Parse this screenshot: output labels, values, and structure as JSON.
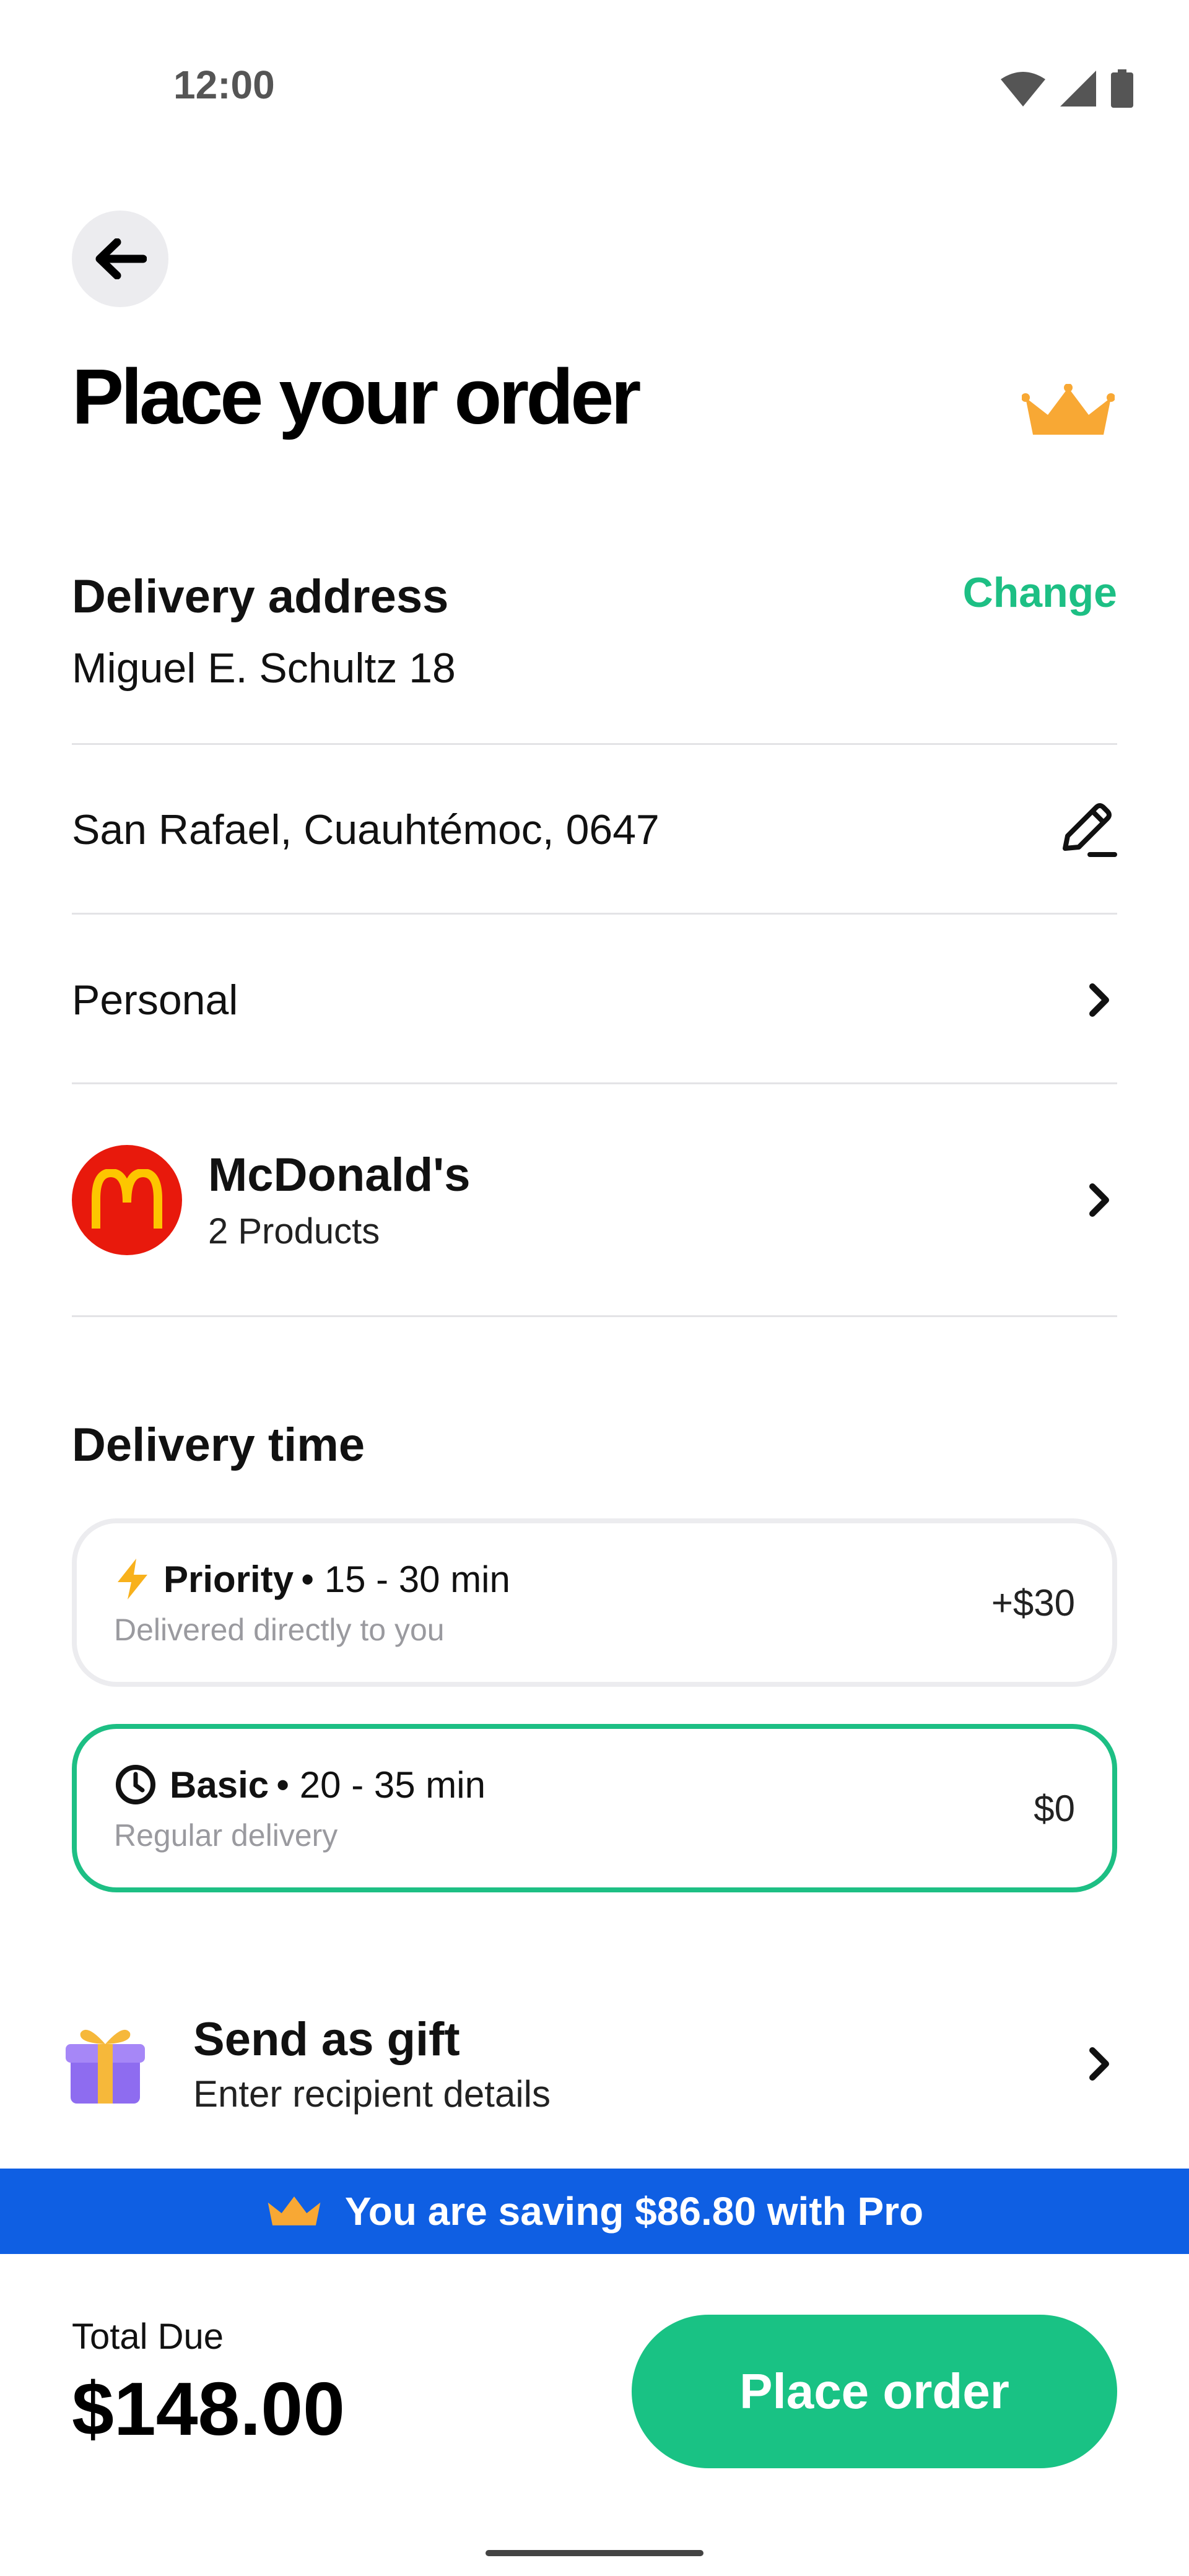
{
  "status_bar": {
    "time": "12:00",
    "icons": [
      "wifi-icon",
      "signal-icon",
      "battery-icon"
    ]
  },
  "header": {
    "title": "Place your order",
    "back_icon": "arrow-left-icon",
    "badge_icon": "crown-icon"
  },
  "delivery_address": {
    "title": "Delivery address",
    "change_label": "Change",
    "name": "Miguel E. Schultz 18",
    "address": "San Rafael, Cuauhtémoc, 0647",
    "type": "Personal"
  },
  "restaurant": {
    "name": "McDonald's",
    "products": "2 Products"
  },
  "delivery_time": {
    "title": "Delivery time",
    "options": [
      {
        "name": "Priority",
        "time": "• 15 - 30 min",
        "subtitle": "Delivered directly to you",
        "price": "+$30",
        "icon": "lightning-icon",
        "selected": false
      },
      {
        "name": "Basic",
        "time": "• 20 - 35 min",
        "subtitle": "Regular delivery",
        "price": "$0",
        "icon": "clock-icon",
        "selected": true
      }
    ]
  },
  "gift": {
    "title": "Send as gift",
    "subtitle": "Enter recipient details"
  },
  "savings_banner": {
    "text": "You are saving $86.80 with Pro"
  },
  "footer": {
    "total_label": "Total Due",
    "total_amount": "$148.00",
    "place_order_label": "Place order"
  },
  "colors": {
    "accent_green": "#1dbf84",
    "banner_blue": "#0f5fe3",
    "mcdonalds_red": "#e8190c",
    "crown_gold": "#f8a834"
  }
}
